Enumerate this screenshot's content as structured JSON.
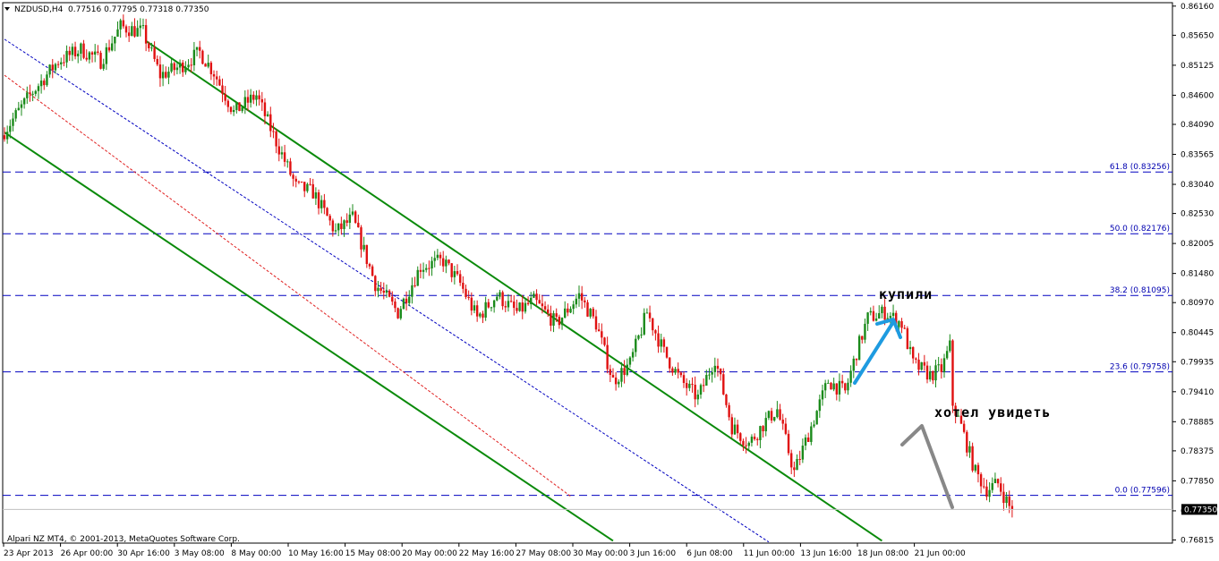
{
  "header": {
    "symbol": "NZDUSD,H4",
    "ohlc": "0.77516 0.77795 0.77318 0.77350"
  },
  "footer": {
    "copyright": "Alpari NZ MT4, © 2001-2013, MetaQuotes Software Corp."
  },
  "current_price": "0.77350",
  "colors": {
    "bull": "#1a8a1a",
    "bear": "#e01010",
    "channel": "#0a8a0a",
    "fib": "#0000c0",
    "median_red": "#e02020",
    "median_blue": "#0000c0",
    "arrow_blue": "#1e9be0",
    "arrow_gray": "#888888"
  },
  "chart_data": {
    "type": "candlestick",
    "ylim": [
      0.7676,
      0.8622
    ],
    "y_ticks": [
      "0.86160",
      "0.85650",
      "0.85125",
      "0.84600",
      "0.84090",
      "0.83565",
      "0.83040",
      "0.82530",
      "0.82005",
      "0.81480",
      "0.80970",
      "0.80445",
      "0.79935",
      "0.79410",
      "0.78885",
      "0.78375",
      "0.77850",
      "0.77325",
      "0.76815"
    ],
    "x_ticks": [
      "23 Apr 2013",
      "26 Apr 00:00",
      "30 Apr 16:00",
      "3 May 08:00",
      "8 May 00:00",
      "10 May 16:00",
      "15 May 08:00",
      "20 May 00:00",
      "22 May 16:00",
      "27 May 08:00",
      "30 May 00:00",
      "3 Jun 16:00",
      "6 Jun 08:00",
      "11 Jun 00:00",
      "13 Jun 16:00",
      "18 Jun 08:00",
      "21 Jun 00:00"
    ],
    "fib_levels": [
      {
        "label": "61.8 (0.83256)",
        "value": 0.83256
      },
      {
        "label": "50.0 (0.82176)",
        "value": 0.82176
      },
      {
        "label": "38.2 (0.81095)",
        "value": 0.81095
      },
      {
        "label": "23.6 (0.79758)",
        "value": 0.79758
      },
      {
        "label": "0.0 (0.77596)",
        "value": 0.77596
      }
    ],
    "anchors": [
      [
        0,
        0.839
      ],
      [
        10,
        0.846
      ],
      [
        20,
        0.852
      ],
      [
        28,
        0.854
      ],
      [
        35,
        0.852
      ],
      [
        42,
        0.858
      ],
      [
        50,
        0.857
      ],
      [
        56,
        0.8495
      ],
      [
        63,
        0.851
      ],
      [
        70,
        0.8535
      ],
      [
        75,
        0.85
      ],
      [
        82,
        0.843
      ],
      [
        90,
        0.846
      ],
      [
        96,
        0.839
      ],
      [
        104,
        0.83
      ],
      [
        110,
        0.829
      ],
      [
        118,
        0.822
      ],
      [
        124,
        0.8245
      ],
      [
        132,
        0.813
      ],
      [
        140,
        0.808
      ],
      [
        148,
        0.816
      ],
      [
        156,
        0.817
      ],
      [
        162,
        0.813
      ],
      [
        168,
        0.807
      ],
      [
        175,
        0.811
      ],
      [
        182,
        0.808
      ],
      [
        188,
        0.81
      ],
      [
        196,
        0.806
      ],
      [
        204,
        0.811
      ],
      [
        210,
        0.806
      ],
      [
        216,
        0.796
      ],
      [
        222,
        0.799
      ],
      [
        228,
        0.808
      ],
      [
        234,
        0.801
      ],
      [
        240,
        0.796
      ],
      [
        246,
        0.793
      ],
      [
        252,
        0.8
      ],
      [
        258,
        0.788
      ],
      [
        264,
        0.785
      ],
      [
        270,
        0.789
      ],
      [
        274,
        0.791
      ],
      [
        280,
        0.78
      ],
      [
        286,
        0.788
      ],
      [
        292,
        0.796
      ],
      [
        298,
        0.794
      ],
      [
        302,
        0.801
      ],
      [
        306,
        0.807
      ],
      [
        312,
        0.808
      ],
      [
        318,
        0.806
      ],
      [
        322,
        0.799
      ],
      [
        328,
        0.797
      ],
      [
        332,
        0.798
      ],
      [
        335,
        0.802
      ],
      [
        336,
        0.792
      ],
      [
        339,
        0.788
      ],
      [
        344,
        0.78
      ],
      [
        348,
        0.777
      ],
      [
        352,
        0.778
      ],
      [
        356,
        0.774
      ]
    ]
  },
  "annotations": {
    "bought": "купили",
    "wanted_to_see": "хотел увидеть"
  }
}
